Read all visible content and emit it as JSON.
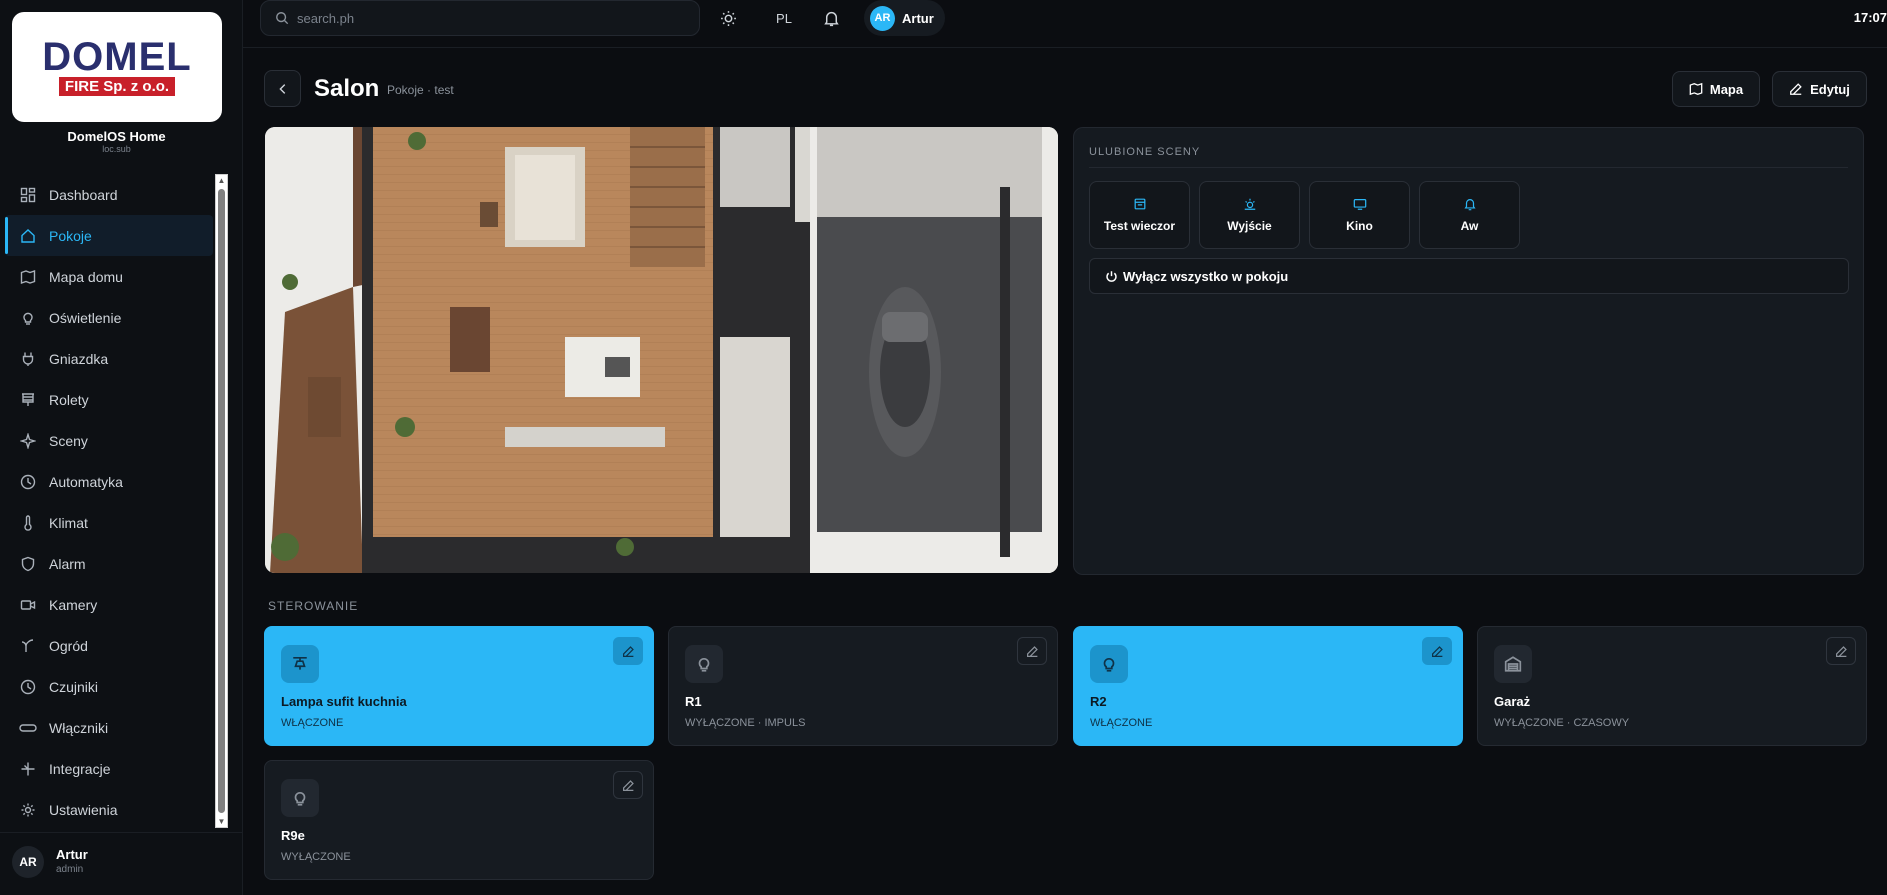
{
  "sidebar": {
    "logo_main": "DOMEL",
    "logo_sub": "FIRE Sp. z o.o.",
    "home_title": "DomelOS Home",
    "home_subtitle": "loc.sub",
    "items": [
      {
        "label": "Dashboard",
        "icon": "dashboard-icon"
      },
      {
        "label": "Pokoje",
        "icon": "home-icon",
        "active": true
      },
      {
        "label": "Mapa domu",
        "icon": "map-icon"
      },
      {
        "label": "Oświetlenie",
        "icon": "bulb-icon"
      },
      {
        "label": "Gniazdka",
        "icon": "plug-icon"
      },
      {
        "label": "Rolety",
        "icon": "blinds-icon"
      },
      {
        "label": "Sceny",
        "icon": "sparkle-icon"
      },
      {
        "label": "Automatyka",
        "icon": "clock-icon"
      },
      {
        "label": "Klimat",
        "icon": "thermometer-icon"
      },
      {
        "label": "Alarm",
        "icon": "shield-icon"
      },
      {
        "label": "Kamery",
        "icon": "camera-icon"
      },
      {
        "label": "Ogród",
        "icon": "sprout-icon"
      },
      {
        "label": "Czujniki",
        "icon": "sensor-icon"
      },
      {
        "label": "Włączniki",
        "icon": "switch-icon"
      },
      {
        "label": "Integracje",
        "icon": "integration-icon"
      },
      {
        "label": "Ustawienia",
        "icon": "gear-icon"
      }
    ],
    "user": {
      "initials": "AR",
      "name": "Artur",
      "role": "admin"
    }
  },
  "topbar": {
    "search_placeholder": "search.ph",
    "language": "PL",
    "user_initials": "AR",
    "user_name": "Artur",
    "clock": "17:07"
  },
  "header": {
    "title": "Salon",
    "subtitle": "Pokoje · test",
    "map_button": "Mapa",
    "edit_button": "Edytuj"
  },
  "scenes": {
    "heading": "ULUBIONE SCENY",
    "items": [
      {
        "label": "Test wieczor",
        "icon": "calendar-icon"
      },
      {
        "label": "Wyjście",
        "icon": "sun-icon"
      },
      {
        "label": "Kino",
        "icon": "monitor-icon"
      },
      {
        "label": "Aw",
        "icon": "bell-icon"
      }
    ],
    "all_off": "Wyłącz wszystko w pokoju"
  },
  "controls": {
    "heading": "STEROWANIE",
    "devices": [
      {
        "name": "Lampa sufit kuchnia",
        "status": "WŁĄCZONE",
        "on": true,
        "icon": "ceiling-lamp-icon"
      },
      {
        "name": "R1",
        "status": "WYŁĄCZONE · IMPULS",
        "on": false,
        "icon": "bulb-icon"
      },
      {
        "name": "R2",
        "status": "WŁĄCZONE",
        "on": true,
        "icon": "bulb-icon"
      },
      {
        "name": "Garaż",
        "status": "WYŁĄCZONE · CZASOWY",
        "on": false,
        "icon": "garage-icon"
      },
      {
        "name": "R9e",
        "status": "WYŁĄCZONE",
        "on": false,
        "icon": "bulb-icon"
      }
    ]
  },
  "colors": {
    "accent": "#2bb7f6",
    "background": "#0b0d11",
    "panel": "#151a20"
  }
}
